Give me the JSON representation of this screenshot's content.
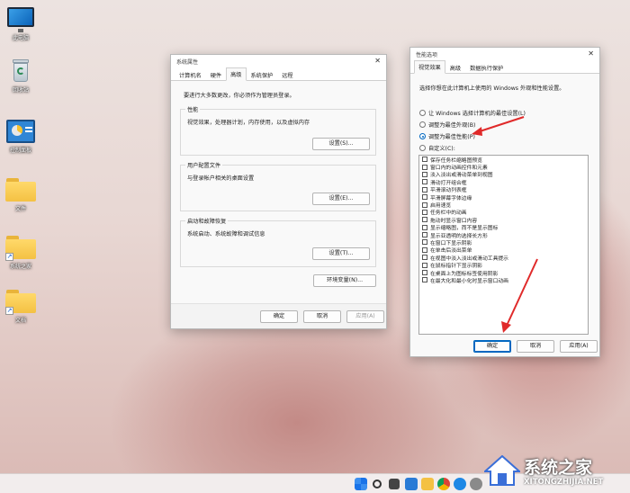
{
  "desktop": {
    "icons": [
      {
        "name": "此电脑",
        "type": "monitor"
      },
      {
        "name": "回收站",
        "type": "recycle-bin"
      },
      {
        "name": "控制面板",
        "type": "control-panel"
      },
      {
        "name": "文件",
        "type": "folder"
      },
      {
        "name": "系统之家",
        "type": "folder-shortcut"
      },
      {
        "name": "文档",
        "type": "folder-shortcut"
      }
    ]
  },
  "sys_props": {
    "title": "系统属性",
    "close_glyph": "✕",
    "tabs": [
      "计算机名",
      "硬件",
      "高级",
      "系统保护",
      "远程"
    ],
    "active_tab": "高级",
    "admin_note": "要进行大多数更改，你必须作为管理员登录。",
    "performance": {
      "title": "性能",
      "desc": "视觉效果，处理器计划，内存使用，以及虚拟内存",
      "button": "设置(S)..."
    },
    "user_profiles": {
      "title": "用户配置文件",
      "desc": "与登录帐户相关的桌面设置",
      "button": "设置(E)..."
    },
    "startup_recovery": {
      "title": "启动和故障恢复",
      "desc": "系统启动、系统故障和调试信息",
      "button": "设置(T)..."
    },
    "env_button": "环境变量(N)...",
    "ok": "确定",
    "cancel": "取消",
    "apply": "应用(A)"
  },
  "perf_options": {
    "title": "性能选项",
    "close_glyph": "✕",
    "tabs": [
      "视觉效果",
      "高级",
      "数据执行保护"
    ],
    "active_tab": "视觉效果",
    "intro": "选择你想在此计算机上使用的 Windows 外观和性能设置。",
    "radios": [
      {
        "label": "让 Windows 选择计算机的最佳设置(L)",
        "checked": false
      },
      {
        "label": "调整为最佳外观(B)",
        "checked": false
      },
      {
        "label": "调整为最佳性能(P)",
        "checked": true
      },
      {
        "label": "自定义(C):",
        "checked": false
      }
    ],
    "checkboxes": [
      "保存任务栏缩略图预览",
      "窗口内的动画控件和元素",
      "淡入淡出或滑动菜单到视图",
      "滑动打开组合框",
      "平滑滚动列表框",
      "平滑屏幕字体边缘",
      "启用速览",
      "任务栏中的动画",
      "拖动时显示窗口内容",
      "显示缩略图，而不是显示图标",
      "显示亚透明的选择长方形",
      "在窗口下显示阴影",
      "在单击后淡出菜单",
      "在视图中淡入淡出或滑动工具提示",
      "在鼠标指针下显示阴影",
      "在桌面上为图标标签使用阴影",
      "在最大化和最小化时显示窗口动画"
    ],
    "ok": "确定",
    "cancel": "取消",
    "apply": "应用(A)"
  },
  "watermark": {
    "brand": "系统之家",
    "url": "XITONGZHIJIA.NET"
  },
  "colors": {
    "accent": "#0067c0",
    "annotation_red": "#e02a2a",
    "folder": "#f4c143"
  }
}
